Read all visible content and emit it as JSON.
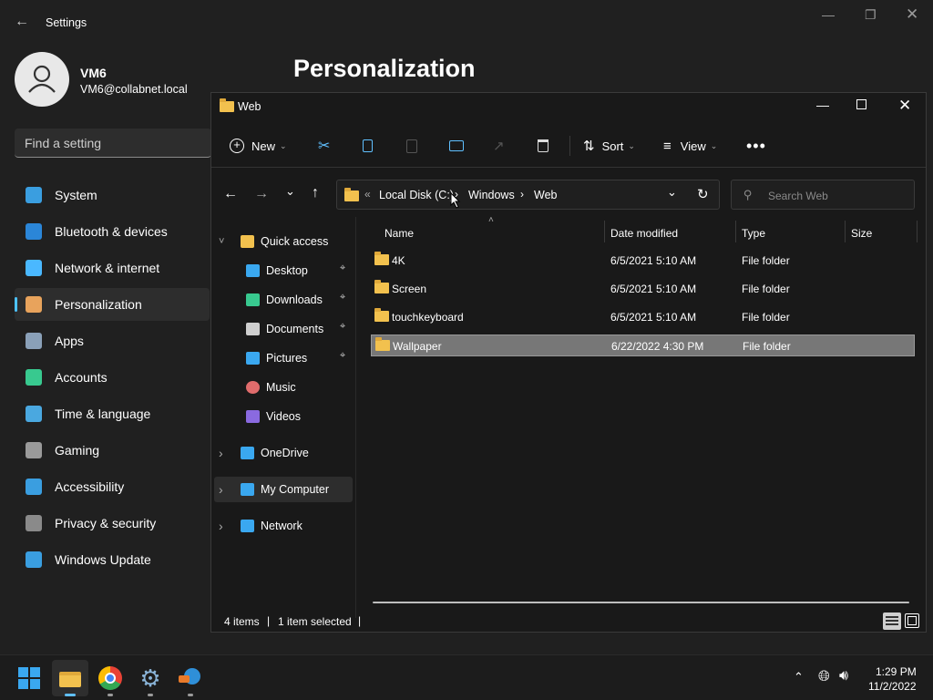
{
  "settings": {
    "title": "Settings",
    "user_name": "VM6",
    "user_email": "VM6@collabnet.local",
    "search_placeholder": "Find a setting",
    "page_heading": "Personalization",
    "nav": [
      {
        "label": "System",
        "icon": "system-icon",
        "color": "#3a9ee0"
      },
      {
        "label": "Bluetooth & devices",
        "icon": "bluetooth-icon",
        "color": "#2b86d8"
      },
      {
        "label": "Network & internet",
        "icon": "wifi-icon",
        "color": "#4ab8ff"
      },
      {
        "label": "Personalization",
        "icon": "brush-icon",
        "color": "#e8a35c",
        "active": true
      },
      {
        "label": "Apps",
        "icon": "apps-icon",
        "color": "#8aa0b8"
      },
      {
        "label": "Accounts",
        "icon": "person-icon",
        "color": "#38c98f"
      },
      {
        "label": "Time & language",
        "icon": "globe-clock-icon",
        "color": "#4aa8e0"
      },
      {
        "label": "Gaming",
        "icon": "gamepad-icon",
        "color": "#9a9a9a"
      },
      {
        "label": "Accessibility",
        "icon": "accessibility-icon",
        "color": "#3a9ee0"
      },
      {
        "label": "Privacy & security",
        "icon": "shield-icon",
        "color": "#8a8a8a"
      },
      {
        "label": "Windows Update",
        "icon": "update-icon",
        "color": "#3a9ee0"
      }
    ]
  },
  "explorer": {
    "title": "Web",
    "toolbar": {
      "new": "New",
      "sort": "Sort",
      "view": "View"
    },
    "breadcrumb": {
      "root": "Local Disk (C:)",
      "part1": "Windows",
      "part2": "Web"
    },
    "search_placeholder": "Search Web",
    "tree": [
      {
        "label": "Quick access",
        "icon": "star-icon",
        "level": 0,
        "expanded": true
      },
      {
        "label": "Desktop",
        "icon": "desktop-icon",
        "level": 1,
        "pinned": true
      },
      {
        "label": "Downloads",
        "icon": "download-icon",
        "level": 1,
        "pinned": true
      },
      {
        "label": "Documents",
        "icon": "document-icon",
        "level": 1,
        "pinned": true
      },
      {
        "label": "Pictures",
        "icon": "pictures-icon",
        "level": 1,
        "pinned": true
      },
      {
        "label": "Music",
        "icon": "music-icon",
        "level": 1
      },
      {
        "label": "Videos",
        "icon": "videos-icon",
        "level": 1
      },
      {
        "label": "OneDrive",
        "icon": "cloud-icon",
        "level": 0
      },
      {
        "label": "My Computer",
        "icon": "computer-icon",
        "level": 0,
        "selected": true
      },
      {
        "label": "Network",
        "icon": "network-icon",
        "level": 0
      }
    ],
    "columns": [
      "Name",
      "Date modified",
      "Type",
      "Size"
    ],
    "rows": [
      {
        "name": "4K",
        "date": "6/5/2021 5:10 AM",
        "type": "File folder"
      },
      {
        "name": "Screen",
        "date": "6/5/2021 5:10 AM",
        "type": "File folder"
      },
      {
        "name": "touchkeyboard",
        "date": "6/5/2021 5:10 AM",
        "type": "File folder"
      },
      {
        "name": "Wallpaper",
        "date": "6/22/2022 4:30 PM",
        "type": "File folder",
        "selected": true
      }
    ],
    "status_items": "4 items",
    "status_selected": "1 item selected"
  },
  "taskbar": {
    "time": "1:29 PM",
    "date": "11/2/2022",
    "apps": [
      "windows-start-icon",
      "file-explorer-icon",
      "chrome-icon",
      "settings-gear-icon",
      "network-globe-icon"
    ]
  }
}
